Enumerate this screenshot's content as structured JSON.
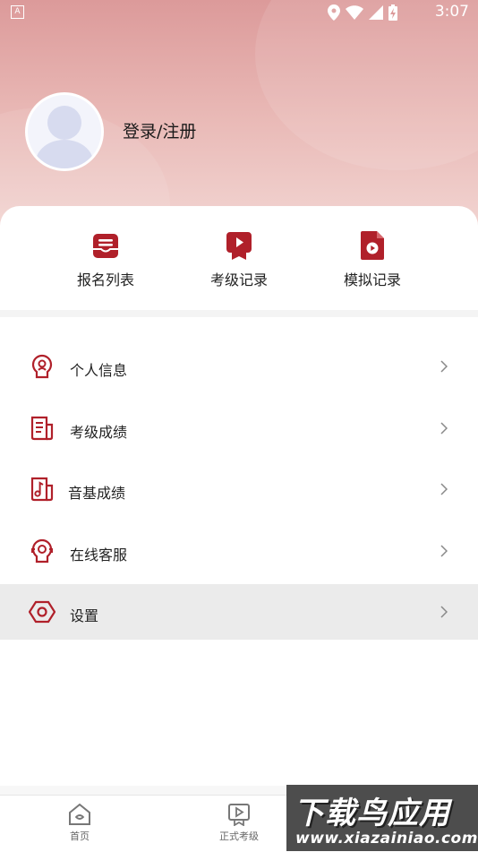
{
  "status_bar": {
    "indicator": "A",
    "time": "3:07",
    "icons": [
      "location-icon",
      "wifi-icon",
      "signal-icon",
      "battery-charging-icon"
    ]
  },
  "profile": {
    "login_label": "登录/注册"
  },
  "quick_actions": [
    {
      "label": "报名列表",
      "icon": "registration-list-icon"
    },
    {
      "label": "考级记录",
      "icon": "exam-record-icon"
    },
    {
      "label": "模拟记录",
      "icon": "mock-record-icon"
    }
  ],
  "menu": [
    {
      "label": "个人信息",
      "icon": "personal-info-icon"
    },
    {
      "label": "考级成绩",
      "icon": "exam-score-icon"
    },
    {
      "label": "音基成绩",
      "icon": "music-theory-score-icon"
    },
    {
      "label": "在线客服",
      "icon": "customer-service-icon"
    },
    {
      "label": "设置",
      "icon": "settings-icon"
    }
  ],
  "tabbar": [
    {
      "label": "首页",
      "icon": "home-icon"
    },
    {
      "label": "正式考级",
      "icon": "formal-exam-icon"
    }
  ],
  "watermark": {
    "title": "下载鸟应用",
    "url": "www.xiazainiao.com"
  },
  "colors": {
    "accent": "#b0202a",
    "header_top": "#dc9a9a",
    "header_bottom": "#f4dcd9"
  }
}
